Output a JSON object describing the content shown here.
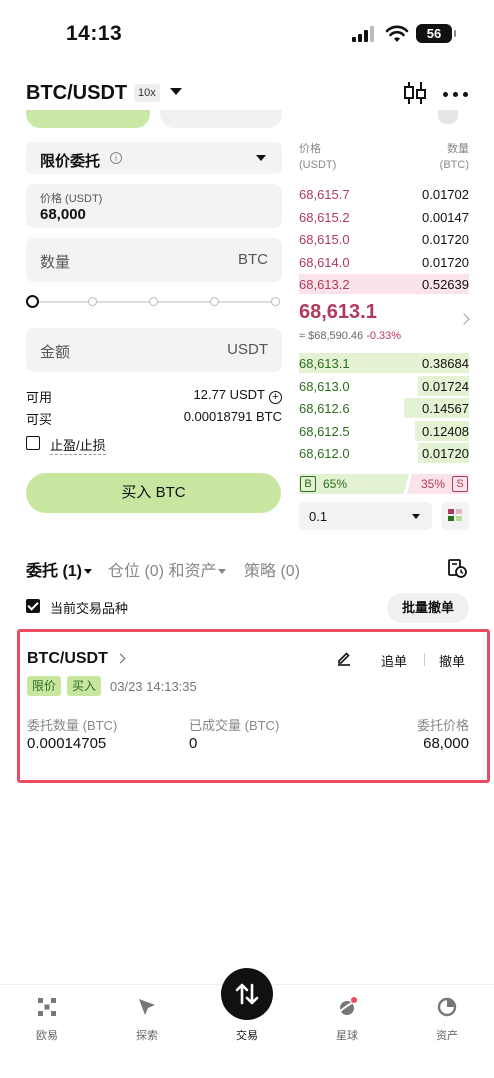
{
  "status_bar": {
    "time": "14:13",
    "battery": "56"
  },
  "header": {
    "pair": "BTC/USDT",
    "leverage": "10x"
  },
  "order_form": {
    "order_type": "限价委托",
    "price_label": "价格 (USDT)",
    "price_value": "68,000",
    "qty_placeholder": "数量",
    "qty_unit": "BTC",
    "amount_placeholder": "金额",
    "amount_unit": "USDT",
    "slider_percent": 0,
    "available_label": "可用",
    "available_value": "12.77 USDT",
    "can_buy_label": "可买",
    "can_buy_value": "0.00018791 BTC",
    "tpsl_label": "止盈/止损",
    "buy_button": "买入 BTC"
  },
  "order_book": {
    "price_header": [
      "价格",
      "(USDT)"
    ],
    "qty_header": [
      "数量",
      "(BTC)"
    ],
    "asks": [
      {
        "price": "68,615.7",
        "qty": "0.01702",
        "depth": 0.0
      },
      {
        "price": "68,615.2",
        "qty": "0.00147",
        "depth": 0.0
      },
      {
        "price": "68,615.0",
        "qty": "0.01720",
        "depth": 0.0
      },
      {
        "price": "68,614.0",
        "qty": "0.01720",
        "depth": 0.0
      },
      {
        "price": "68,613.2",
        "qty": "0.52639",
        "depth": 1.0
      }
    ],
    "mid_price": "68,613.1",
    "mid_ref": "≈ $68,590.46",
    "mid_change": "-0.33%",
    "bids": [
      {
        "price": "68,613.1",
        "qty": "0.38684",
        "depth": 1.0
      },
      {
        "price": "68,613.0",
        "qty": "0.01724",
        "depth": 0.3
      },
      {
        "price": "68,612.6",
        "qty": "0.14567",
        "depth": 0.38
      },
      {
        "price": "68,612.5",
        "qty": "0.12408",
        "depth": 0.32
      },
      {
        "price": "68,612.0",
        "qty": "0.01720",
        "depth": 0.3
      }
    ],
    "buy_tag": "B",
    "buy_ratio": "65%",
    "sell_tag": "S",
    "sell_ratio": "35%",
    "depth_value": "0.1"
  },
  "orders": {
    "tabs": [
      {
        "label": "委托 (1)"
      },
      {
        "label": "仓位 (0) 和资产"
      },
      {
        "label": "策略 (0)"
      }
    ],
    "current_filter": "当前交易品种",
    "cancel_all": "批量撤单",
    "card": {
      "pair": "BTC/USDT",
      "chase": "追单",
      "cancel": "撤单",
      "badge_type": "限价",
      "badge_side": "买入",
      "time": "03/23 14:13:35",
      "qty_label": "委托数量 (BTC)",
      "qty_value": "0.00014705",
      "filled_label": "已成交量 (BTC)",
      "filled_value": "0",
      "price_label": "委托价格",
      "price_value": "68,000"
    }
  },
  "bottom_nav": [
    {
      "label": "欧易",
      "icon": "okx-logo-icon"
    },
    {
      "label": "探索",
      "icon": "compass-icon"
    },
    {
      "label": "交易",
      "icon": "trade-swap-icon"
    },
    {
      "label": "星球",
      "icon": "planet-icon"
    },
    {
      "label": "资产",
      "icon": "pie-chart-icon"
    }
  ],
  "colors": {
    "buy": "#2b6e1d",
    "sell": "#b03a5b",
    "highlight": "#ec4c62",
    "buy_button": "#c8e6a0"
  }
}
